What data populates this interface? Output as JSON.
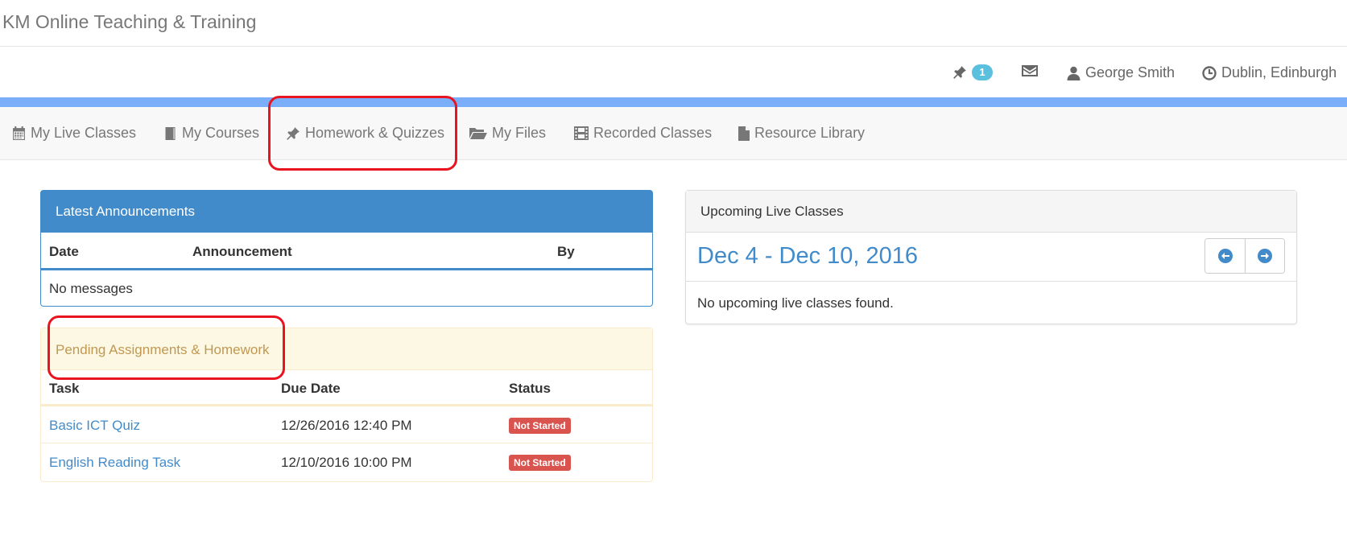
{
  "app": {
    "title": "KM Online Teaching & Training"
  },
  "topbar": {
    "pin_badge": "1",
    "user_name": "George Smith",
    "timezone": "Dublin, Edinburgh"
  },
  "nav": {
    "items": [
      {
        "label": "My Live Classes",
        "icon": "calendar-icon"
      },
      {
        "label": "My Courses",
        "icon": "book-icon"
      },
      {
        "label": "Homework & Quizzes",
        "icon": "pushpin-icon"
      },
      {
        "label": "My Files",
        "icon": "folder-open-icon"
      },
      {
        "label": "Recorded Classes",
        "icon": "film-icon"
      },
      {
        "label": "Resource Library",
        "icon": "file-icon"
      }
    ]
  },
  "announcements": {
    "title": "Latest Announcements",
    "columns": [
      "Date",
      "Announcement",
      "By"
    ],
    "empty_text": "No messages"
  },
  "pending": {
    "title": "Pending Assignments & Homework",
    "columns": [
      "Task",
      "Due Date",
      "Status"
    ],
    "rows": [
      {
        "task": "Basic ICT Quiz",
        "due": "12/26/2016 12:40 PM",
        "status": "Not Started"
      },
      {
        "task": "English Reading Task",
        "due": "12/10/2016 10:00 PM",
        "status": "Not Started"
      }
    ]
  },
  "upcoming": {
    "title": "Upcoming Live Classes",
    "range": "Dec 4 - Dec 10, 2016",
    "empty_text": "No upcoming live classes found."
  },
  "colors": {
    "primary": "#428bca",
    "warning_bg": "#fcf8e3",
    "warning_text": "#c09853",
    "danger": "#d9534f",
    "info_badge": "#5bc0de",
    "stripe": "#7aaef9",
    "annotation_red": "#e8141f"
  }
}
